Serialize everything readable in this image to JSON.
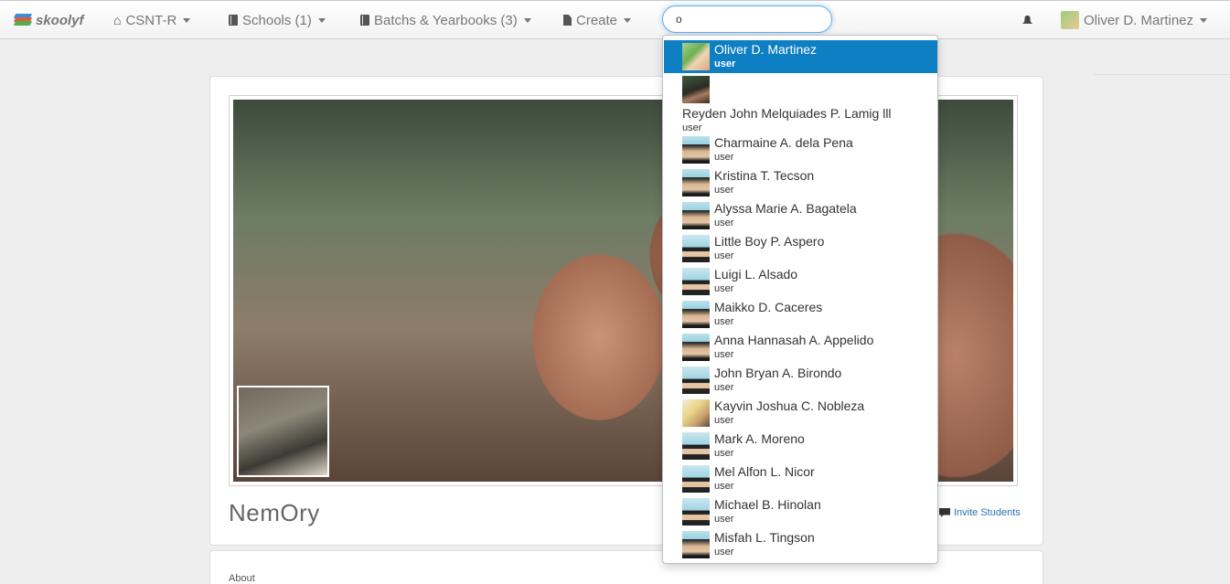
{
  "navbar": {
    "brand": "skoolyf",
    "home_label": "CSNT-R",
    "schools_label": "Schools (1)",
    "batchs_label": "Batchs & Yearbooks (3)",
    "create_label": "Create",
    "search_value": "o",
    "user_name": "Oliver D. Martinez"
  },
  "main": {
    "title": "NemOry",
    "invite_label": "Invite Students",
    "about_label": "About"
  },
  "search_results": [
    {
      "name": "Oliver D. Martinez",
      "role": "user"
    },
    {
      "name": "Reyden John Melquiades P. Lamig lll",
      "role": "user"
    },
    {
      "name": "Charmaine A. dela Pena",
      "role": "user"
    },
    {
      "name": "Kristina T. Tecson",
      "role": "user"
    },
    {
      "name": "Alyssa Marie A. Bagatela",
      "role": "user"
    },
    {
      "name": "Little Boy P. Aspero",
      "role": "user"
    },
    {
      "name": "Luigi L. Alsado",
      "role": "user"
    },
    {
      "name": "Maikko D. Caceres",
      "role": "user"
    },
    {
      "name": "Anna Hannasah A. Appelido",
      "role": "user"
    },
    {
      "name": "John Bryan A. Birondo",
      "role": "user"
    },
    {
      "name": "Kayvin Joshua C. Nobleza",
      "role": "user"
    },
    {
      "name": "Mark A. Moreno",
      "role": "user"
    },
    {
      "name": "Mel Alfon L. Nicor",
      "role": "user"
    },
    {
      "name": "Michael B. Hinolan",
      "role": "user"
    },
    {
      "name": "Misfah L. Tingson",
      "role": "user"
    }
  ],
  "icons": {
    "home": "home-icon",
    "book": "book-icon",
    "doc": "document-icon",
    "bell": "bell-icon",
    "chat": "comment-icon"
  },
  "colors": {
    "accent": "#0f7fc4",
    "link": "#2a6fb3",
    "focus_ring": "#66afe9"
  }
}
